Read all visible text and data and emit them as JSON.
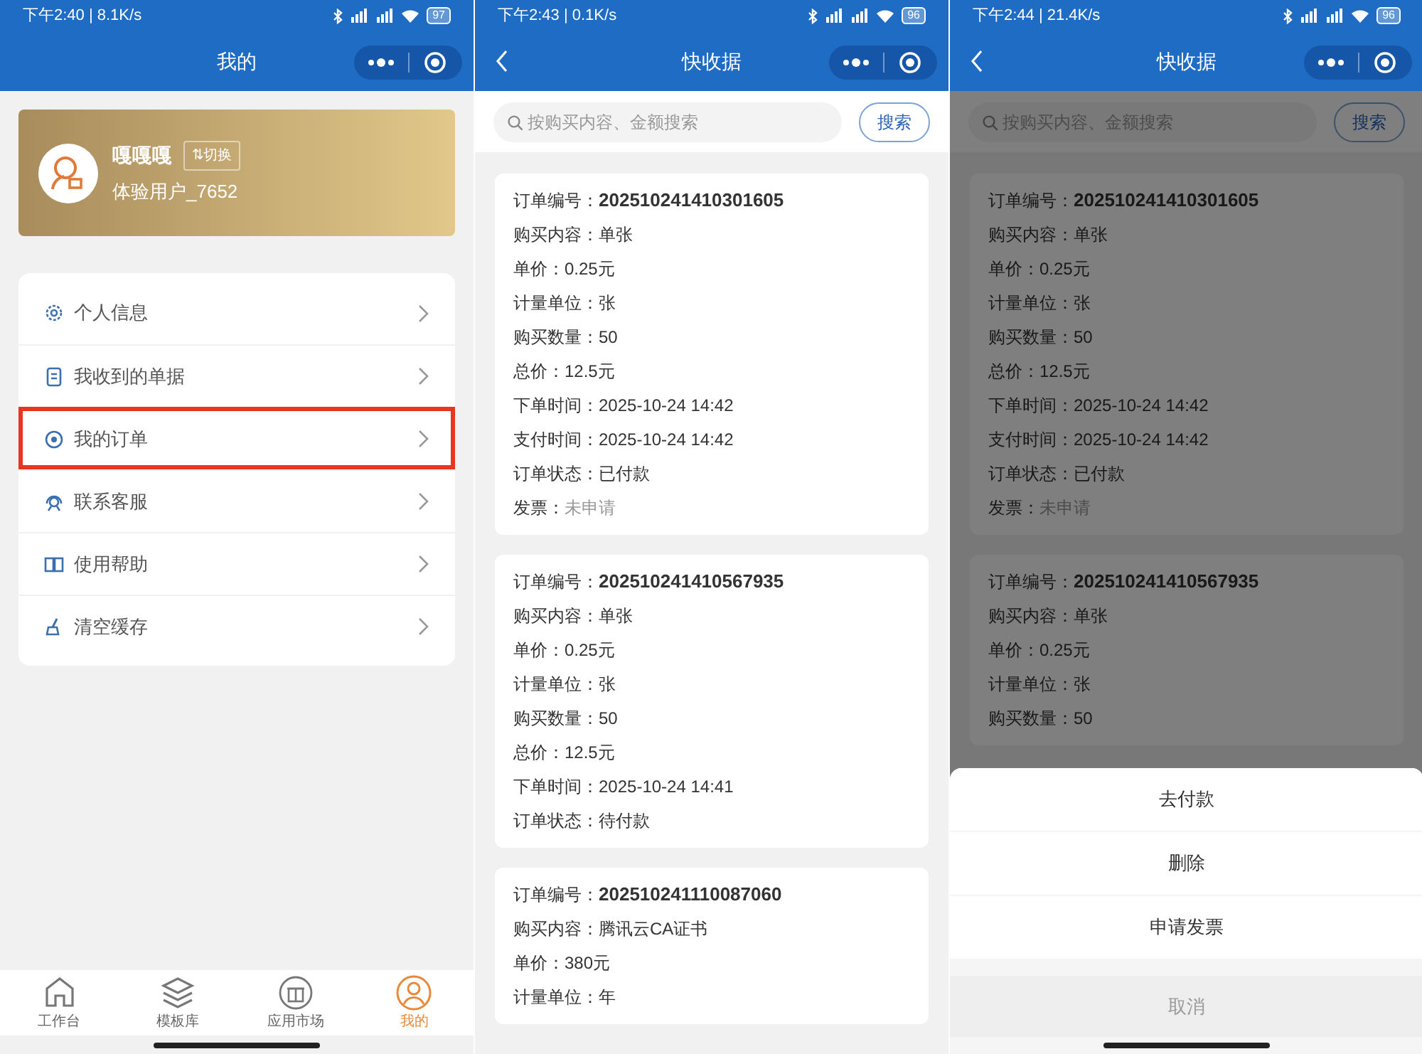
{
  "screens": [
    {
      "kind": "profile",
      "status_bar": {
        "time": "下午2:40 | 8.1K/s",
        "battery": "97"
      },
      "title": "我的",
      "profile": {
        "name": "嘎嘎嘎",
        "switch_label": "⇅切换",
        "user_id": "体验用户_7652"
      },
      "menu": [
        {
          "label": "个人信息",
          "highlighted": false
        },
        {
          "label": "我收到的单据",
          "highlighted": false
        },
        {
          "label": "我的订单",
          "highlighted": true
        },
        {
          "label": "联系客服",
          "highlighted": false
        },
        {
          "label": "使用帮助",
          "highlighted": false
        },
        {
          "label": "清空缓存",
          "highlighted": false
        }
      ],
      "tabs": [
        {
          "label": "工作台",
          "selected": false
        },
        {
          "label": "模板库",
          "selected": false
        },
        {
          "label": "应用市场",
          "selected": false
        },
        {
          "label": "我的",
          "selected": true
        }
      ]
    },
    {
      "kind": "orders",
      "status_bar": {
        "time": "下午2:43 | 0.1K/s",
        "battery": "96"
      },
      "title": "快收据",
      "back": true,
      "search": {
        "placeholder": "按购买内容、金额搜索",
        "button": "搜索"
      },
      "orders": [
        {
          "number_label": "订单编号：",
          "number": "202510241410301605",
          "fields": [
            {
              "label": "购买内容：",
              "value": "单张",
              "muted": false
            },
            {
              "label": "单价：",
              "value": "0.25元",
              "muted": false
            },
            {
              "label": "计量单位：",
              "value": "张",
              "muted": false
            },
            {
              "label": "购买数量：",
              "value": "50",
              "muted": false
            },
            {
              "label": "总价：",
              "value": "12.5元",
              "muted": false
            },
            {
              "label": "下单时间：",
              "value": "2025-10-24 14:42",
              "muted": false
            },
            {
              "label": "支付时间：",
              "value": "2025-10-24 14:42",
              "muted": false
            },
            {
              "label": "订单状态：",
              "value": "已付款",
              "muted": false
            },
            {
              "label": "发票：",
              "value": "未申请",
              "muted": true
            }
          ]
        },
        {
          "number_label": "订单编号：",
          "number": "202510241410567935",
          "fields": [
            {
              "label": "购买内容：",
              "value": "单张",
              "muted": false
            },
            {
              "label": "单价：",
              "value": "0.25元",
              "muted": false
            },
            {
              "label": "计量单位：",
              "value": "张",
              "muted": false
            },
            {
              "label": "购买数量：",
              "value": "50",
              "muted": false
            },
            {
              "label": "总价：",
              "value": "12.5元",
              "muted": false
            },
            {
              "label": "下单时间：",
              "value": "2025-10-24 14:41",
              "muted": false
            },
            {
              "label": "订单状态：",
              "value": "待付款",
              "muted": false
            }
          ]
        },
        {
          "number_label": "订单编号：",
          "number": "202510241110087060",
          "fields": [
            {
              "label": "购买内容：",
              "value": "腾讯云CA证书",
              "muted": false
            },
            {
              "label": "单价：",
              "value": "380元",
              "muted": false
            },
            {
              "label": "计量单位：",
              "value": "年",
              "muted": false
            }
          ]
        }
      ]
    },
    {
      "kind": "orders",
      "status_bar": {
        "time": "下午2:44 | 21.4K/s",
        "battery": "96"
      },
      "title": "快收据",
      "back": true,
      "search": {
        "placeholder": "按购买内容、金额搜索",
        "button": "搜索"
      },
      "orders": [
        {
          "number_label": "订单编号：",
          "number": "202510241410301605",
          "fields": [
            {
              "label": "购买内容：",
              "value": "单张",
              "muted": false
            },
            {
              "label": "单价：",
              "value": "0.25元",
              "muted": false
            },
            {
              "label": "计量单位：",
              "value": "张",
              "muted": false
            },
            {
              "label": "购买数量：",
              "value": "50",
              "muted": false
            },
            {
              "label": "总价：",
              "value": "12.5元",
              "muted": false
            },
            {
              "label": "下单时间：",
              "value": "2025-10-24 14:42",
              "muted": false
            },
            {
              "label": "支付时间：",
              "value": "2025-10-24 14:42",
              "muted": false
            },
            {
              "label": "订单状态：",
              "value": "已付款",
              "muted": false
            },
            {
              "label": "发票：",
              "value": "未申请",
              "muted": true
            }
          ]
        },
        {
          "number_label": "订单编号：",
          "number": "202510241410567935",
          "fields": [
            {
              "label": "购买内容：",
              "value": "单张",
              "muted": false
            },
            {
              "label": "单价：",
              "value": "0.25元",
              "muted": false
            },
            {
              "label": "计量单位：",
              "value": "张",
              "muted": false
            },
            {
              "label": "购买数量：",
              "value": "50",
              "muted": false
            }
          ]
        }
      ],
      "action_sheet": {
        "actions": [
          "去付款",
          "删除",
          "申请发票"
        ],
        "cancel": "取消"
      }
    }
  ]
}
